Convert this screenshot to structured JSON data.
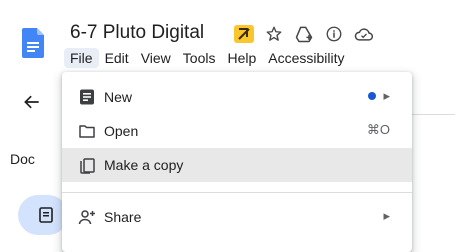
{
  "document": {
    "title": "6-7 Pluto Digital"
  },
  "menubar": {
    "items": [
      "File",
      "Edit",
      "View",
      "Tools",
      "Help",
      "Accessibility"
    ]
  },
  "left_panel": {
    "outline_label": "Doc"
  },
  "file_menu": {
    "items": [
      {
        "label": "New",
        "icon": "document-icon",
        "badge": "dot",
        "submenu": true
      },
      {
        "label": "Open",
        "icon": "folder-icon",
        "shortcut": "⌘O"
      },
      {
        "label": "Make a copy",
        "icon": "copy-icon",
        "highlighted": true
      },
      {
        "label": "Share",
        "icon": "person-add-icon",
        "submenu": true
      }
    ],
    "submenu_glyph": "▸"
  },
  "colors": {
    "accent_blue": "#1a56d6",
    "doc_blue": "#4285f4",
    "hover_grey": "#e8e8e8",
    "menubar_active": "#e9eef6",
    "pill": "#d3e3fd"
  }
}
